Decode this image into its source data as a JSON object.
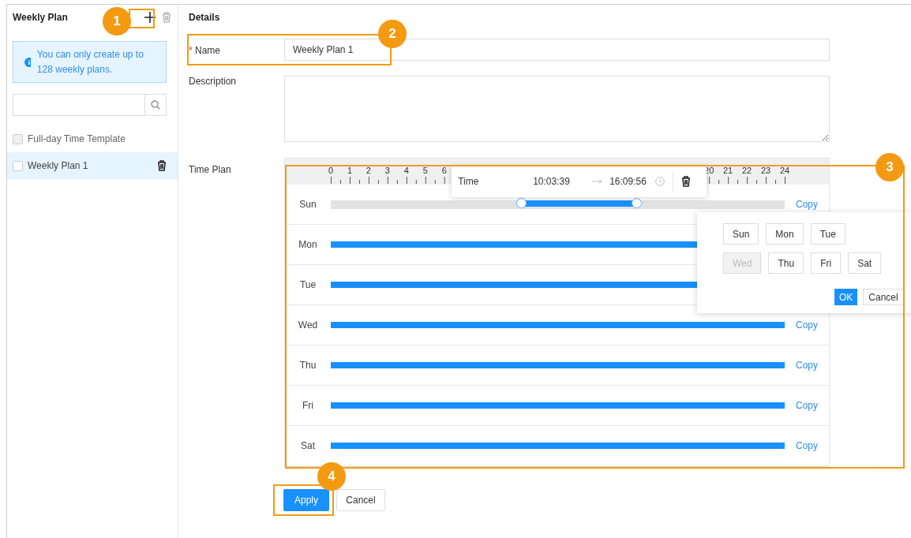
{
  "sidebar": {
    "title": "Weekly Plan",
    "info": "You can only create up to 128 weekly plans.",
    "items": [
      {
        "label": "Full-day Time Template",
        "checked": false,
        "disabled": true,
        "selected": false,
        "deletable": false
      },
      {
        "label": "Weekly Plan 1",
        "checked": false,
        "disabled": false,
        "selected": true,
        "deletable": true
      }
    ]
  },
  "details": {
    "title": "Details",
    "name": {
      "label": "Name",
      "required_mark": "*",
      "value": "Weekly Plan 1"
    },
    "description": {
      "label": "Description"
    },
    "time_plan": {
      "label": "Time Plan",
      "ruler": {
        "left_labels": [
          "0",
          "1",
          "2",
          "3",
          "4",
          "5",
          "6"
        ],
        "right_labels": [
          "20",
          "21",
          "22",
          "23",
          "24"
        ]
      },
      "tooltip": {
        "label": "Time",
        "start": "10:03:39",
        "end": "16:09:56"
      },
      "days": [
        {
          "day": "Sun",
          "kind": "range",
          "selected": true,
          "copy": "Copy"
        },
        {
          "day": "Mon",
          "kind": "full"
        },
        {
          "day": "Tue",
          "kind": "full"
        },
        {
          "day": "Wed",
          "kind": "full",
          "copy": "Copy"
        },
        {
          "day": "Thu",
          "kind": "full",
          "copy": "Copy"
        },
        {
          "day": "Fri",
          "kind": "full",
          "copy": "Copy"
        },
        {
          "day": "Sat",
          "kind": "full",
          "copy": "Copy"
        }
      ],
      "copy_popover": {
        "days": [
          {
            "label": "Sun",
            "disabled": false
          },
          {
            "label": "Mon",
            "disabled": false
          },
          {
            "label": "Tue",
            "disabled": false
          },
          {
            "label": "Wed",
            "disabled": true
          },
          {
            "label": "Thu",
            "disabled": false
          },
          {
            "label": "Fri",
            "disabled": false
          },
          {
            "label": "Sat",
            "disabled": false
          }
        ],
        "ok": "OK",
        "cancel": "Cancel"
      }
    },
    "actions": {
      "apply": "Apply",
      "cancel": "Cancel"
    }
  },
  "callouts": [
    "1",
    "2",
    "3",
    "4"
  ]
}
